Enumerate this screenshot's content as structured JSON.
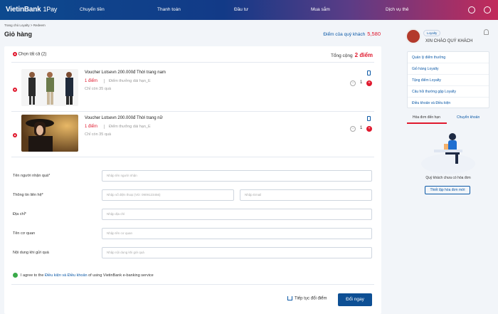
{
  "header": {
    "brand": "VietinBank",
    "brand_sub": "1Pay",
    "nav": [
      "Chuyển tiền",
      "Thanh toán",
      "Đầu tư",
      "Mua sắm",
      "Dịch vụ thẻ"
    ],
    "colors": {
      "accent": "#e0192e",
      "primary": "#0d4f94"
    }
  },
  "breadcrumb": "Trang chủ Loyalty  >  Redeem",
  "page_title": "Giỏ hàng",
  "customer_points": {
    "label": "Điểm của quý khách",
    "value": "5,580"
  },
  "cart": {
    "select_all": "Chọn tất cả (2)",
    "total_label": "Tổng cộng",
    "total_value": "2 điểm",
    "items": [
      {
        "name": "Voucher Lotsevn 200.000đ Thời trang nam",
        "points": "1 điểm",
        "tag": "Điểm thưởng dài hạn_E",
        "remaining": "Chỉ còn 35 quà",
        "qty": "1"
      },
      {
        "name": "Voucher Lotsevn 200.000đ Thời trang nữ",
        "points": "1 điểm",
        "tag": "Điểm thưởng dài hạn_E",
        "remaining": "Chỉ còn 35 quà",
        "qty": "1"
      }
    ]
  },
  "form": {
    "recipient_label": "Tên người nhận quà*",
    "recipient_placeholder": "Nhập tên người nhận",
    "contact_label": "Thông tin liên hệ*",
    "phone_placeholder": "Nhập số điện thoại (VD: 0909123456)",
    "email_placeholder": "Nhập Email",
    "address_label": "Địa chỉ*",
    "address_placeholder": "Nhập địa chỉ",
    "agency_label": "Tên cơ quan",
    "agency_placeholder": "Nhập tên cơ quan",
    "message_label": "Nội dung khi gửi quà",
    "message_placeholder": "Nhập nội dung khi gửi quà",
    "agree_prefix": "I agree to the",
    "agree_link": "Điều kiện và Điều khoản",
    "agree_suffix": "of using VietinBank e-banking service",
    "continue_label": "Tiếp tục đổi điểm",
    "redeem_label": "Đổi ngay"
  },
  "sidebar": {
    "badge": "Loyalty",
    "greeting": "XIN CHÀO QUÝ KHÁCH",
    "menu": [
      "Quản lý điểm thưởng",
      "Giỏ hàng Loyalty",
      "Tặng điểm Loyalty",
      "Câu hỏi thường gặp Loyalty",
      "Điều khoản và Điều kiện"
    ],
    "tabs": [
      "Hóa đơn đến hạn",
      "Chuyển khoản"
    ],
    "empty_text": "Quý khách chưa có hóa đơn",
    "new_button": "Thiết lập hóa đơn mới"
  }
}
